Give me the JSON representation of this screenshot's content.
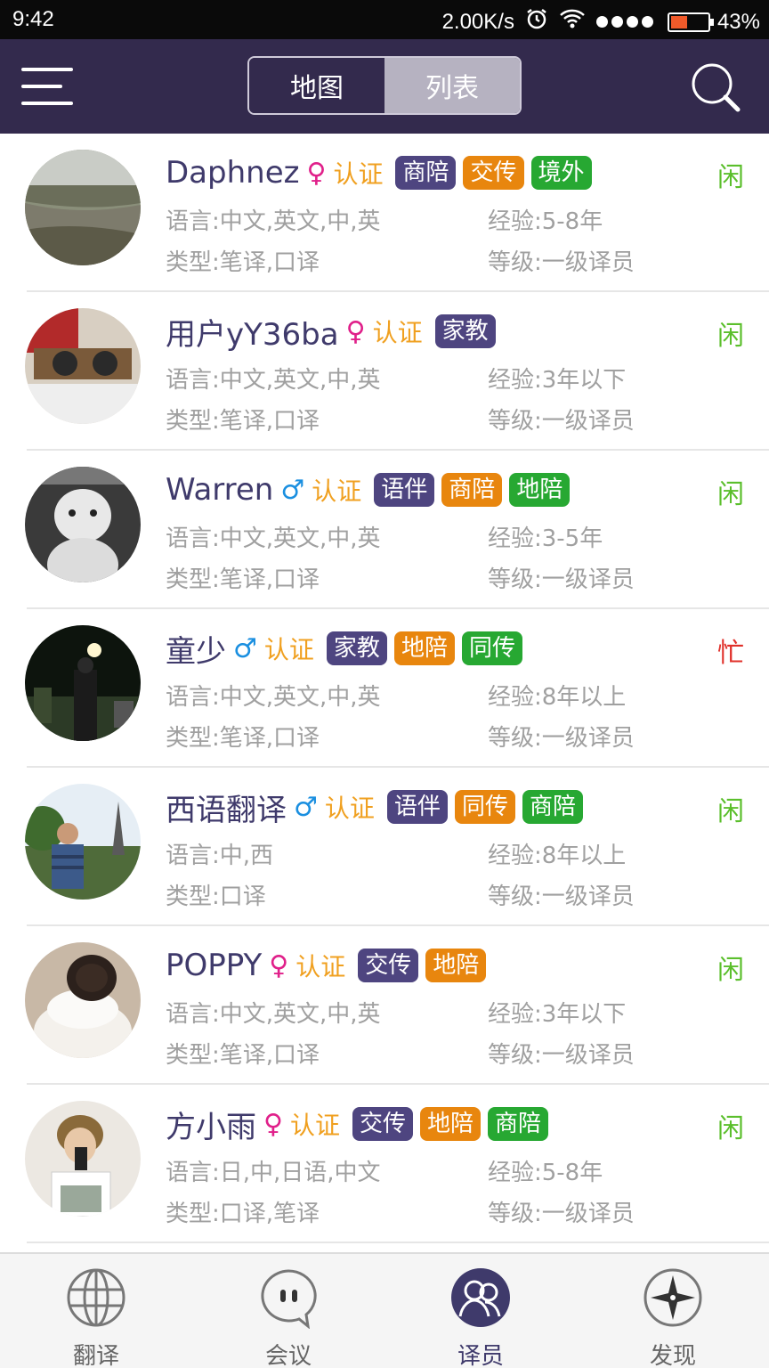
{
  "status_bar": {
    "time": "9:42",
    "speed": "2.00K/s",
    "battery": "43%",
    "battery_level": 0.43
  },
  "header": {
    "tab_map": "地图",
    "tab_list": "列表",
    "active_tab": "列表"
  },
  "labels": {
    "verified": "认证"
  },
  "colors": {
    "header_bg": "#332a4d",
    "tag_purple": "#4e4580",
    "tag_orange": "#e8860e",
    "tag_green": "#27a832",
    "idle": "#5bbf2c",
    "busy": "#e0302a",
    "verified": "#f0a020"
  },
  "translators": [
    {
      "name": "Daphnez",
      "gender": "♀",
      "gender_type": "female",
      "tags": [
        {
          "label": "商陪",
          "color": "purple"
        },
        {
          "label": "交传",
          "color": "orange"
        },
        {
          "label": "境外",
          "color": "green"
        }
      ],
      "status": "闲",
      "status_type": "idle",
      "language": "语言:中文,英文,中,英",
      "experience": "经验:5-8年",
      "type": "类型:笔译,口译",
      "level": "等级:一级译员"
    },
    {
      "name": "用户yY36ba",
      "gender": "♀",
      "gender_type": "female",
      "tags": [
        {
          "label": "家教",
          "color": "purple"
        }
      ],
      "status": "闲",
      "status_type": "idle",
      "language": "语言:中文,英文,中,英",
      "experience": "经验:3年以下",
      "type": "类型:笔译,口译",
      "level": "等级:一级译员"
    },
    {
      "name": "Warren",
      "gender": "♂",
      "gender_type": "male",
      "tags": [
        {
          "label": "语伴",
          "color": "purple"
        },
        {
          "label": "商陪",
          "color": "orange"
        },
        {
          "label": "地陪",
          "color": "green"
        }
      ],
      "status": "闲",
      "status_type": "idle",
      "language": "语言:中文,英文,中,英",
      "experience": "经验:3-5年",
      "type": "类型:笔译,口译",
      "level": "等级:一级译员"
    },
    {
      "name": "童少",
      "gender": "♂",
      "gender_type": "male",
      "tags": [
        {
          "label": "家教",
          "color": "purple"
        },
        {
          "label": "地陪",
          "color": "orange"
        },
        {
          "label": "同传",
          "color": "green"
        }
      ],
      "status": "忙",
      "status_type": "busy",
      "language": "语言:中文,英文,中,英",
      "experience": "经验:8年以上",
      "type": "类型:笔译,口译",
      "level": "等级:一级译员"
    },
    {
      "name": "西语翻译",
      "gender": "♂",
      "gender_type": "male",
      "tags": [
        {
          "label": "语伴",
          "color": "purple"
        },
        {
          "label": "同传",
          "color": "orange"
        },
        {
          "label": "商陪",
          "color": "green"
        }
      ],
      "status": "闲",
      "status_type": "idle",
      "language": "语言:中,西",
      "experience": "经验:8年以上",
      "type": "类型:口译",
      "level": "等级:一级译员"
    },
    {
      "name": "POPPY",
      "gender": "♀",
      "gender_type": "female",
      "tags": [
        {
          "label": "交传",
          "color": "purple"
        },
        {
          "label": "地陪",
          "color": "orange"
        }
      ],
      "status": "闲",
      "status_type": "idle",
      "language": "语言:中文,英文,中,英",
      "experience": "经验:3年以下",
      "type": "类型:笔译,口译",
      "level": "等级:一级译员"
    },
    {
      "name": "方小雨",
      "gender": "♀",
      "gender_type": "female",
      "tags": [
        {
          "label": "交传",
          "color": "purple"
        },
        {
          "label": "地陪",
          "color": "orange"
        },
        {
          "label": "商陪",
          "color": "green"
        }
      ],
      "status": "闲",
      "status_type": "idle",
      "language": "语言:日,中,日语,中文",
      "experience": "经验:5-8年",
      "type": "类型:口译,笔译",
      "level": "等级:一级译员"
    }
  ],
  "bottom_nav": [
    {
      "label": "翻译",
      "icon": "globe-icon"
    },
    {
      "label": "会议",
      "icon": "chat-bubble-icon"
    },
    {
      "label": "译员",
      "icon": "translators-icon",
      "active": true
    },
    {
      "label": "发现",
      "icon": "compass-icon"
    }
  ]
}
